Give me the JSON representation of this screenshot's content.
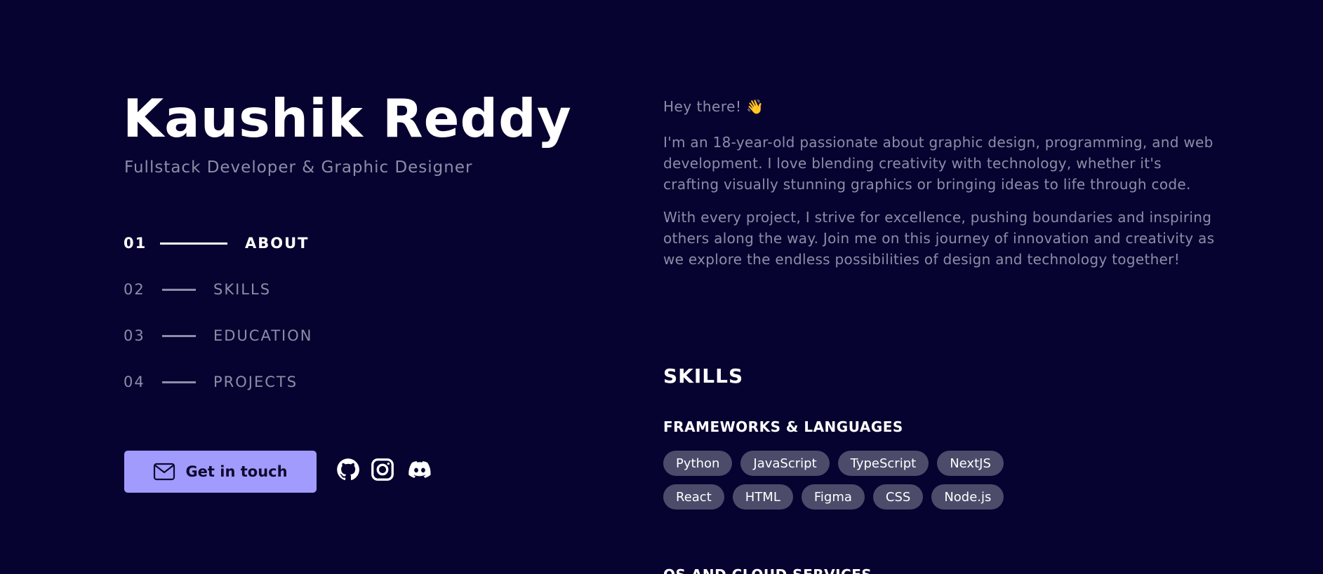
{
  "profile": {
    "name": "Kaushik Reddy",
    "subtitle": "Fullstack Developer & Graphic Designer"
  },
  "nav": {
    "items": [
      {
        "num": "01",
        "label": "ABOUT",
        "active": true
      },
      {
        "num": "02",
        "label": "SKILLS",
        "active": false
      },
      {
        "num": "03",
        "label": "EDUCATION",
        "active": false
      },
      {
        "num": "04",
        "label": "PROJECTS",
        "active": false
      }
    ]
  },
  "cta": {
    "label": "Get in touch",
    "icon": "mail-icon"
  },
  "social": [
    {
      "name": "github-icon"
    },
    {
      "name": "instagram-icon"
    },
    {
      "name": "discord-icon"
    }
  ],
  "about": {
    "greeting": "Hey there! 👋",
    "paragraph1": "I'm an 18-year-old passionate about graphic design, programming, and web development. I love blending creativity with technology, whether it's crafting visually stunning graphics or bringing ideas to life through code.",
    "paragraph2": "With every project, I strive for excellence, pushing boundaries and inspiring others along the way. Join me on this journey of innovation and creativity as we explore the endless possibilities of design and technology together!"
  },
  "skills": {
    "title": "SKILLS",
    "categories": [
      {
        "title": "FRAMEWORKS & LANGUAGES",
        "rows": [
          [
            "Python",
            "JavaScript",
            "TypeScript",
            "NextJS"
          ],
          [
            "React",
            "HTML",
            "Figma",
            "CSS",
            "Node.js"
          ]
        ]
      },
      {
        "title": "OS AND CLOUD SERVICES"
      }
    ]
  },
  "colors": {
    "background": "#070330",
    "accent": "#a29bfe",
    "muted_text": "#8f8ca8",
    "tag_bg": "#4c4b6a"
  }
}
